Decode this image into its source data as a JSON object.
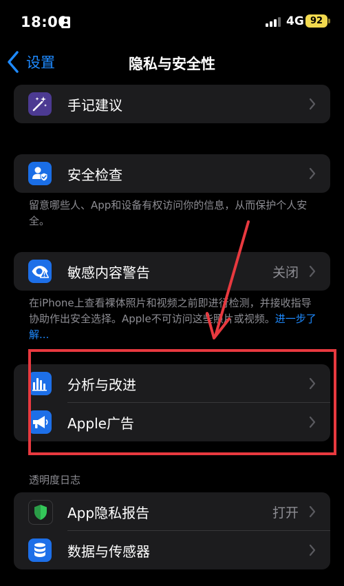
{
  "status_bar": {
    "time": "18:00",
    "network": "4G",
    "battery": "92"
  },
  "nav": {
    "back_label": "设置",
    "title": "隐私与安全性"
  },
  "rows": {
    "journaling": {
      "label": "手记建议"
    },
    "safety_check": {
      "label": "安全检查"
    },
    "sensitive_content": {
      "label": "敏感内容警告",
      "value": "关闭"
    },
    "analytics": {
      "label": "分析与改进"
    },
    "apple_ads": {
      "label": "Apple广告"
    },
    "app_privacy_report": {
      "label": "App隐私报告",
      "value": "打开"
    },
    "data_sensors": {
      "label": "数据与传感器"
    }
  },
  "footers": {
    "safety_check": "留意哪些人、App和设备有权访问你的信息，从而保护个人安全。",
    "sensitive_content": "在iPhone上查看裸体照片和视频之前即进行检测，并接收指导协助作出安全选择。Apple不可访问这些照片或视频。",
    "learn_more": "进一步了解..."
  },
  "sections": {
    "transparency_log": "透明度日志"
  },
  "colors": {
    "accent": "#1e8aff",
    "annotation_red": "#e8393f",
    "group_background": "#1c1c1e"
  }
}
